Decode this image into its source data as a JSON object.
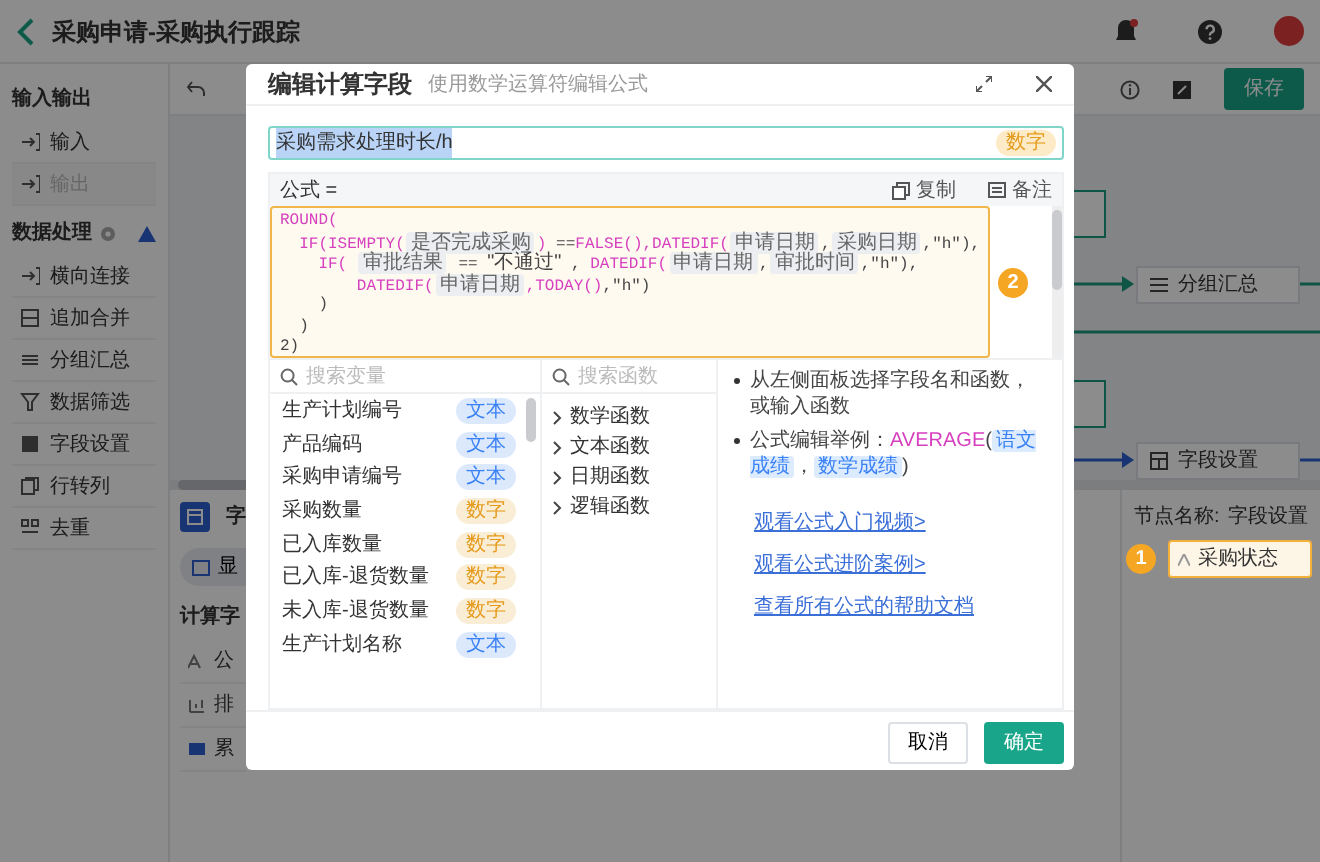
{
  "app_header": {
    "title": "采购申请-采购执行跟踪"
  },
  "sidebar": {
    "sections": [
      {
        "title": "输入输出",
        "items": [
          {
            "label": "输入",
            "disabled": false
          },
          {
            "label": "输出",
            "disabled": true
          }
        ]
      },
      {
        "title": "数据处理",
        "warning": true,
        "items": [
          {
            "label": "横向连接",
            "disabled": false
          },
          {
            "label": "追加合并",
            "disabled": false
          },
          {
            "label": "分组汇总",
            "disabled": false
          },
          {
            "label": "数据筛选",
            "disabled": false
          },
          {
            "label": "字段设置",
            "disabled": false
          },
          {
            "label": "行转列",
            "disabled": false
          },
          {
            "label": "去重",
            "disabled": false
          }
        ]
      }
    ]
  },
  "toolbar": {
    "save_button": "保存"
  },
  "canvas": {
    "nodes": [
      {
        "label": "分组汇总"
      },
      {
        "label": "字段设置"
      }
    ]
  },
  "field_panel": {
    "title": "字",
    "tab": "显",
    "section_title": "计算字",
    "items": [
      {
        "label": "公"
      },
      {
        "label": "排"
      },
      {
        "label": "累"
      }
    ]
  },
  "node_panel": {
    "name_label": "节点名称:",
    "name_value": "字段设置",
    "fields": [
      {
        "label": "采购状态",
        "callout": "1"
      }
    ]
  },
  "dialog": {
    "title": "编辑计算字段",
    "subtitle": "使用数学运算符编辑公式",
    "name_field": {
      "value": "采购需求处理时长/h",
      "text_selected": true,
      "type_badge": "数字"
    },
    "formula": {
      "label": "公式 =",
      "actions": [
        "复制",
        "备注"
      ],
      "callout": "2",
      "lines": [
        [
          {
            "kind": "fn",
            "text": "ROUND("
          }
        ],
        [
          {
            "kind": "fn",
            "text": "  IF(ISEMPTY("
          },
          {
            "kind": "field",
            "text": "是否完成采购"
          },
          {
            "kind": "fn",
            "text": ")"
          },
          {
            "kind": "op",
            "text": " =="
          },
          {
            "kind": "fn",
            "text": "FALSE(),DATEDIF("
          },
          {
            "kind": "field",
            "text": "申请日期"
          },
          {
            "kind": "op",
            "text": ","
          },
          {
            "kind": "field",
            "text": "采购日期"
          },
          {
            "kind": "op",
            "text": ",\"h\"),"
          }
        ],
        [
          {
            "kind": "fn",
            "text": "    IF( "
          },
          {
            "kind": "field",
            "text": "审批结果"
          },
          {
            "kind": "op",
            "text": " == "
          },
          {
            "kind": "str",
            "text": "\"不通过\""
          },
          {
            "kind": "op",
            "text": " , "
          },
          {
            "kind": "fn",
            "text": "DATEDIF("
          },
          {
            "kind": "field",
            "text": "申请日期"
          },
          {
            "kind": "op",
            "text": ","
          },
          {
            "kind": "field",
            "text": "审批时间"
          },
          {
            "kind": "op",
            "text": ",\"h\"),"
          }
        ],
        [
          {
            "kind": "fn",
            "text": "        DATEDIF("
          },
          {
            "kind": "field",
            "text": "申请日期"
          },
          {
            "kind": "fn",
            "text": ",TODAY()"
          },
          {
            "kind": "op",
            "text": ",\"h\")"
          }
        ],
        [
          {
            "kind": "op",
            "text": "    )"
          }
        ],
        [
          {
            "kind": "op",
            "text": "  )"
          }
        ],
        [
          {
            "kind": "op",
            "text": "2)"
          }
        ]
      ]
    },
    "variable_search": {
      "placeholder": "搜索变量"
    },
    "variables": [
      {
        "name": "生产计划编号",
        "type_label": "文本",
        "color": "#3b82f6"
      },
      {
        "name": "产品编码",
        "type_label": "文本",
        "color": "#3b82f6"
      },
      {
        "name": "采购申请编号",
        "type_label": "文本",
        "color": "#3b82f6"
      },
      {
        "name": "采购数量",
        "type_label": "数字",
        "color": "#e49a1a"
      },
      {
        "name": "已入库数量",
        "type_label": "数字",
        "color": "#e49a1a"
      },
      {
        "name": "已入库-退货数量",
        "type_label": "数字",
        "color": "#e49a1a"
      },
      {
        "name": "未入库-退货数量",
        "type_label": "数字",
        "color": "#e49a1a"
      },
      {
        "name": "生产计划名称",
        "type_label": "文本",
        "color": "#3b82f6"
      }
    ],
    "function_search": {
      "placeholder": "搜索函数"
    },
    "function_categories": [
      {
        "label": "数学函数",
        "expanded": false
      },
      {
        "label": "文本函数",
        "expanded": false
      },
      {
        "label": "日期函数",
        "expanded": false
      },
      {
        "label": "逻辑函数",
        "expanded": false
      }
    ],
    "help": {
      "tips": [
        [
          {
            "kind": "text",
            "text": "从左侧面板选择字段名和函数，或输入函数"
          }
        ],
        [
          {
            "kind": "text",
            "text": "公式编辑举例："
          },
          {
            "kind": "fn",
            "text": "AVERAGE"
          },
          {
            "kind": "op",
            "text": "("
          },
          {
            "kind": "arg",
            "text": "语文成绩"
          },
          {
            "kind": "op",
            "text": "，"
          },
          {
            "kind": "arg",
            "text": "数学成绩"
          },
          {
            "kind": "op",
            "text": ")"
          }
        ]
      ],
      "links": [
        "观看公式入门视频>",
        "观看公式进阶案例>",
        "查看所有公式的帮助文档"
      ]
    },
    "buttons": {
      "cancel": "取消",
      "confirm": "确定"
    }
  }
}
